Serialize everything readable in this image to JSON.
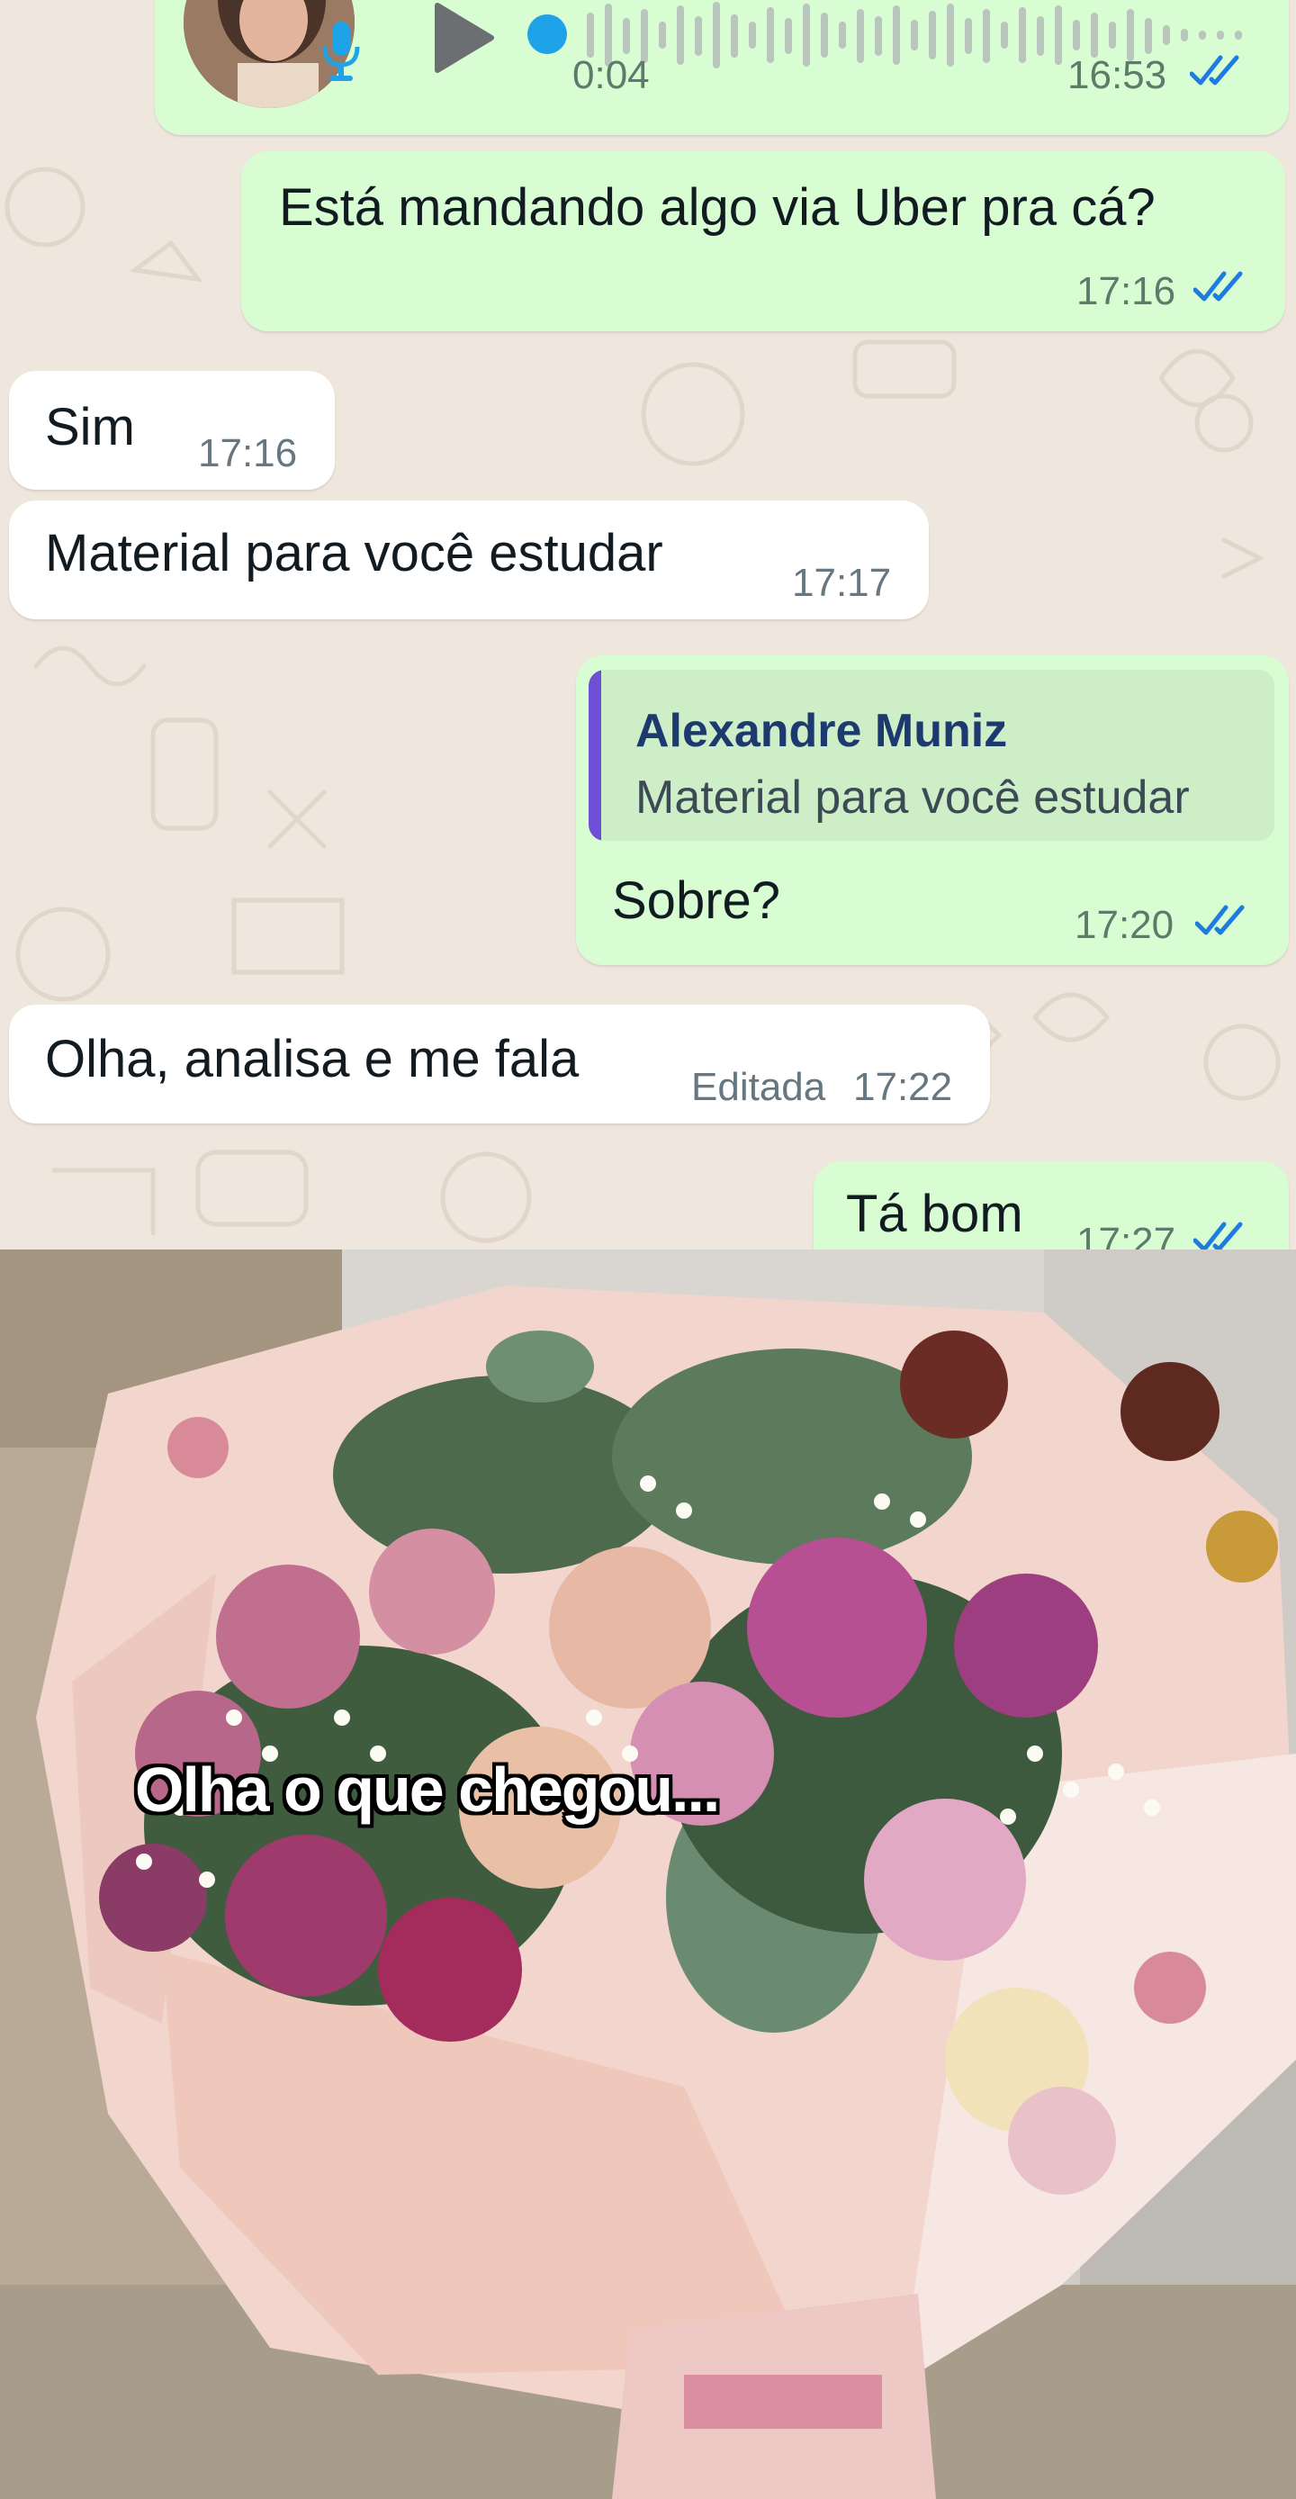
{
  "voice_message": {
    "duration": "0:04",
    "time": "16:53",
    "status": "read",
    "icons": [
      "mic-icon",
      "play-icon"
    ]
  },
  "messages": [
    {
      "direction": "outgoing",
      "text": "Está mandando algo via Uber pra cá?",
      "time": "17:16",
      "status": "read"
    },
    {
      "direction": "incoming",
      "text": "Sim",
      "time": "17:16"
    },
    {
      "direction": "incoming",
      "text": "Material para você estudar",
      "time": "17:17"
    },
    {
      "direction": "outgoing",
      "quote_author": "Alexandre Muniz",
      "quote_text": "Material para você estudar",
      "text": "Sobre?",
      "time": "17:20",
      "status": "read"
    },
    {
      "direction": "incoming",
      "text": "Olha, analisa e me fala",
      "edited_label": "Editada",
      "time": "17:22"
    },
    {
      "direction": "outgoing",
      "text": "Tá bom",
      "time": "17:27",
      "status": "read"
    }
  ],
  "photo": {
    "caption": "Olha o que chegou..."
  },
  "colors": {
    "chat_background": "#efe7dd",
    "outgoing_bubble": "#d9fdd3",
    "incoming_bubble": "#ffffff",
    "read_ticks": "#53bdeb",
    "quote_bar": "#6e4fd6"
  }
}
